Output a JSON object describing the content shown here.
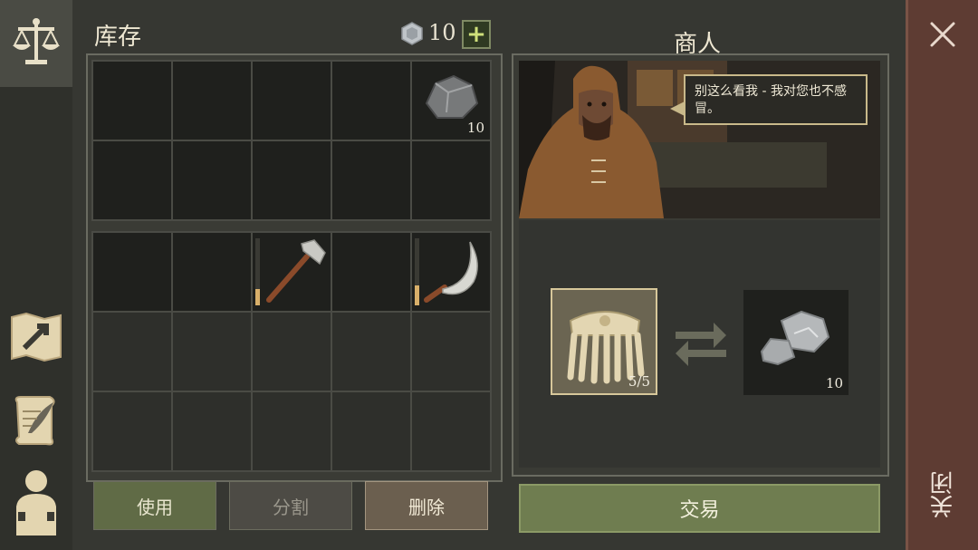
{
  "inventory": {
    "title": "库存",
    "currency_value": "10",
    "add_label": "+",
    "slots_top": [
      {
        "item": "",
        "count": ""
      },
      {
        "item": "",
        "count": ""
      },
      {
        "item": "",
        "count": ""
      },
      {
        "item": "",
        "count": ""
      },
      {
        "item": "stone",
        "count": "10"
      },
      {
        "item": "",
        "count": ""
      },
      {
        "item": "",
        "count": ""
      },
      {
        "item": "",
        "count": ""
      },
      {
        "item": "",
        "count": ""
      },
      {
        "item": "",
        "count": ""
      }
    ],
    "slots_bottom_row1": [
      {
        "item": ""
      },
      {
        "item": ""
      },
      {
        "item": "axe"
      },
      {
        "item": ""
      },
      {
        "item": "sickle"
      }
    ],
    "buttons": {
      "use": "使用",
      "split": "分割",
      "delete": "删除"
    }
  },
  "merchant": {
    "title": "商人",
    "speech": "别这么看我 - 我对您也不感冒。",
    "offer_count": "5/5",
    "receive_count": "10",
    "trade_label": "交易"
  },
  "close": {
    "label": "关闭"
  },
  "colors": {
    "accent_green": "#6f7d50",
    "frame_gold": "#c9b98a",
    "close_bar": "#5e3c33"
  }
}
